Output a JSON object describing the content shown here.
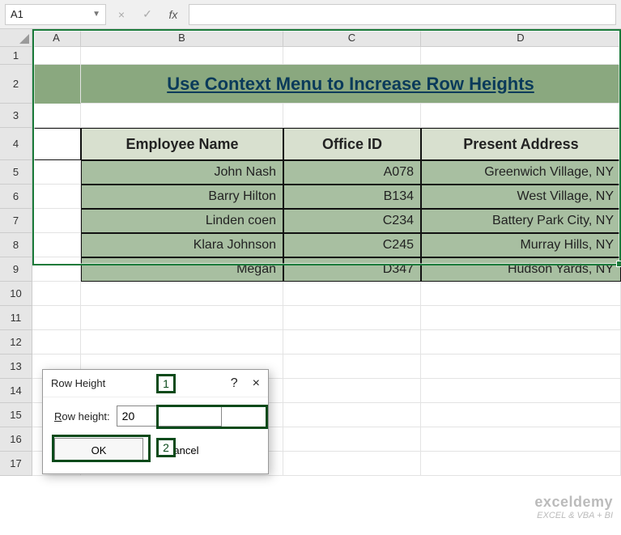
{
  "formula_bar": {
    "name_box": "A1",
    "cancel_glyph": "×",
    "confirm_glyph": "✓",
    "fx_label": "fx",
    "formula": ""
  },
  "columns": {
    "A": "A",
    "B": "B",
    "C": "C",
    "D": "D"
  },
  "row_numbers": [
    "1",
    "2",
    "3",
    "4",
    "5",
    "6",
    "7",
    "8",
    "9",
    "10",
    "11",
    "12",
    "13",
    "14",
    "15",
    "16",
    "17"
  ],
  "title": "Use Context Menu to Increase Row Heights",
  "table": {
    "headers": {
      "b": "Employee Name",
      "c": "Office ID",
      "d": "Present Address"
    },
    "rows": [
      {
        "b": "John Nash",
        "c": "A078",
        "d": "Greenwich Village, NY"
      },
      {
        "b": "Barry Hilton",
        "c": "B134",
        "d": "West Village, NY"
      },
      {
        "b": "Linden coen",
        "c": "C234",
        "d": "Battery Park City, NY"
      },
      {
        "b": "Klara Johnson",
        "c": "C245",
        "d": "Murray Hills, NY"
      },
      {
        "b": "Megan",
        "c": "D347",
        "d": "Hudson Yards, NY"
      }
    ]
  },
  "dialog": {
    "title": "Row Height",
    "help_glyph": "?",
    "close_glyph": "×",
    "label_prefix": "R",
    "label_rest": "ow height:",
    "value": "20",
    "ok": "OK",
    "cancel": "Cancel"
  },
  "annotations": {
    "one": "1",
    "two": "2"
  },
  "watermark": {
    "brand": "exceldemy",
    "tagline": "EXCEL & VBA + BI"
  }
}
